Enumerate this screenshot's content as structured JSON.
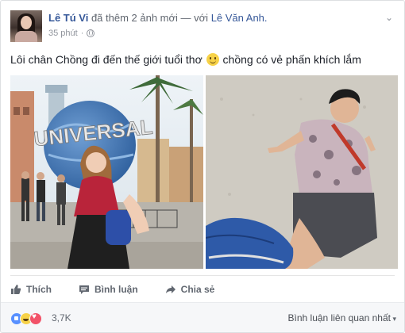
{
  "post": {
    "author": "Lê Tú Vi",
    "action_text": "đã thêm 2 ảnh mới — với",
    "tagged": "Lê Văn Anh.",
    "time": "35 phút",
    "time_separator": "·",
    "message_before_emoji": "Lôi chân Chồng đi đến thế giới tuổi thơ",
    "message_after_emoji": "chồng có vẻ phấn khích lắm",
    "photos": [
      {
        "name": "universal-studios-photo",
        "sign_text": "UNIVERSAL"
      },
      {
        "name": "husband-sitting-photo"
      }
    ]
  },
  "actions": {
    "like": "Thích",
    "comment": "Bình luận",
    "share": "Chia sẻ"
  },
  "reactions": {
    "icons": [
      "like-icon",
      "haha-icon",
      "love-icon"
    ],
    "count": "3,7K",
    "sort_label": "Bình luận liên quan nhất"
  },
  "colors": {
    "link": "#365899",
    "secondary_text": "#616770",
    "meta_text": "#90949c",
    "footer_bg": "#f6f7f9"
  }
}
